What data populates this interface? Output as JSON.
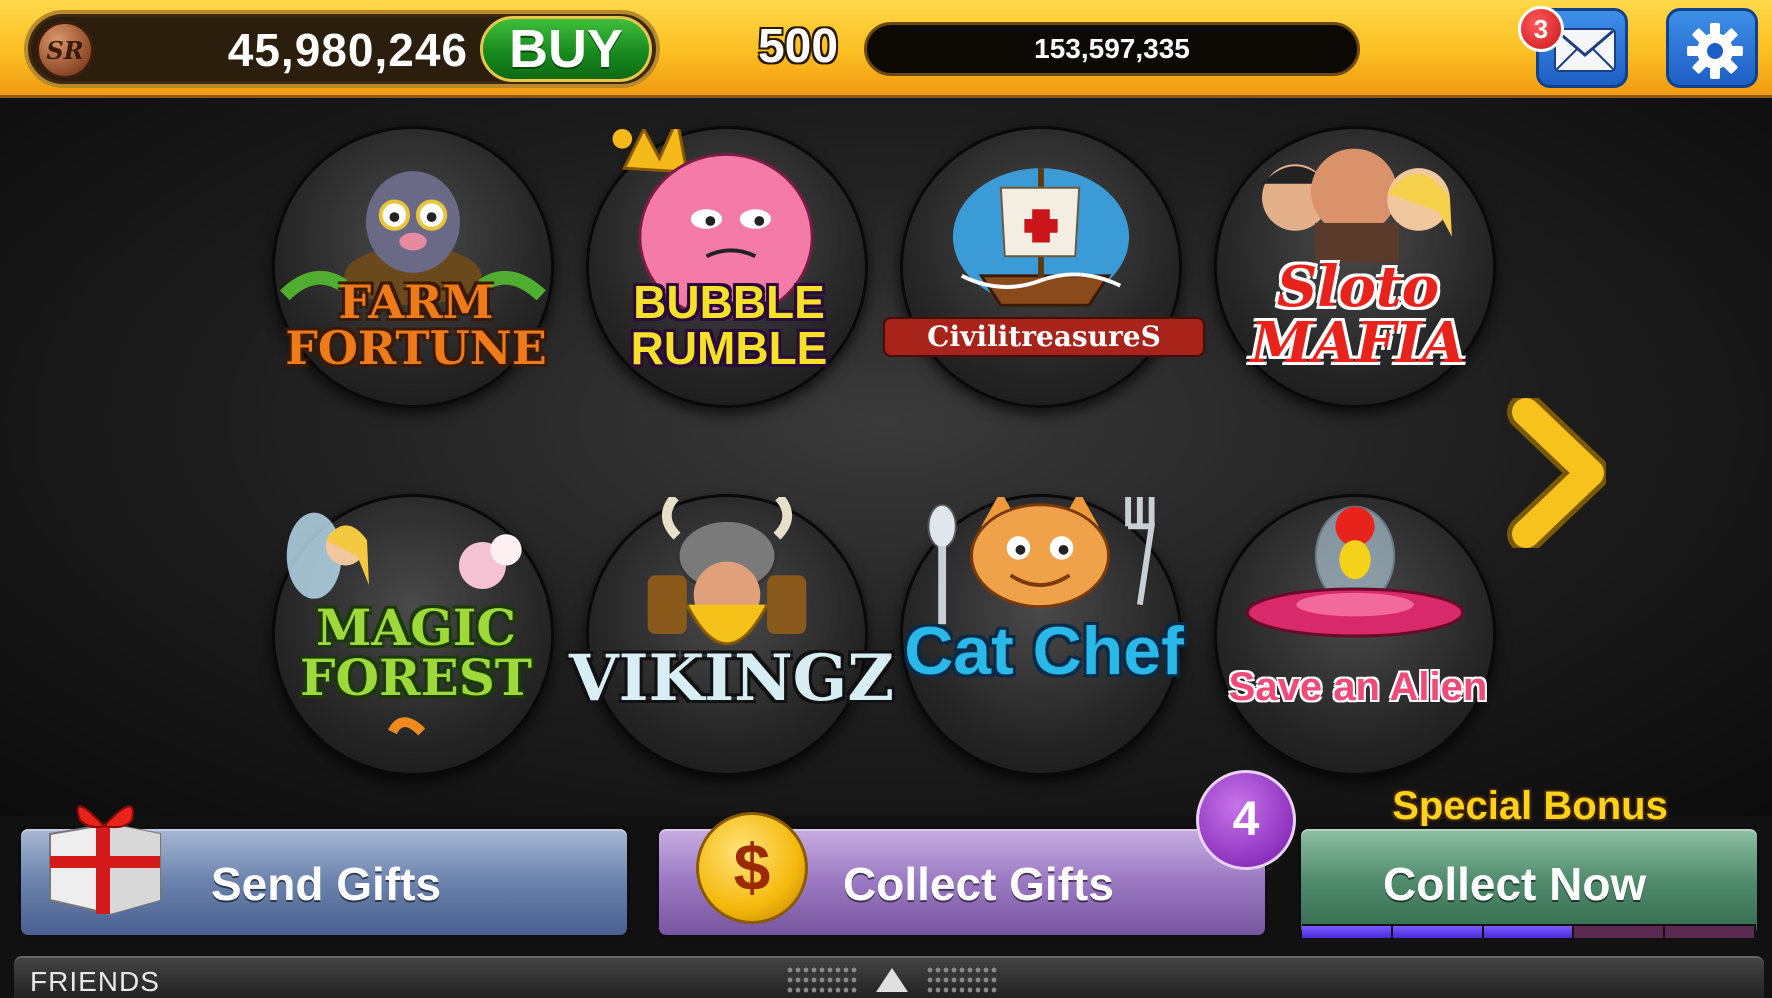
{
  "topbar": {
    "avatar_initials": "SR",
    "coins": "45,980,246",
    "buy_label": "BUY",
    "level": "500",
    "xp_value": "153,597,335",
    "mail_count": "3"
  },
  "games": [
    {
      "title": "FARM FORTUNE",
      "icon": "mole-icon"
    },
    {
      "title": "BUBBLE RUMBLE",
      "icon": "bubble-king-icon"
    },
    {
      "title": "CivilitreasureS",
      "icon": "ship-icon"
    },
    {
      "title": "Sloto MAFIA",
      "icon": "mafia-icon"
    },
    {
      "title": "MAGIC FOREST",
      "icon": "fairy-icon"
    },
    {
      "title": "VIKINGZ",
      "icon": "viking-icon"
    },
    {
      "title": "Cat Chef",
      "icon": "cat-icon"
    },
    {
      "title": "Save an Alien",
      "icon": "ufo-icon"
    }
  ],
  "actions": {
    "send_gifts": "Send Gifts",
    "collect_gifts": "Collect Gifts",
    "collect_gifts_count": "4",
    "special_bonus": "Special Bonus",
    "collect_now": "Collect Now",
    "bonus_progress": 0.6
  },
  "friends": {
    "label": "FRIENDS"
  },
  "colors": {
    "topbar": "#fbbf22",
    "buy_green": "#16861e",
    "send_blue": "#6a82ad",
    "collect_purple": "#9a78c2",
    "collect_now_green": "#4f8a6b",
    "arrow_yellow": "#f7c21b"
  }
}
